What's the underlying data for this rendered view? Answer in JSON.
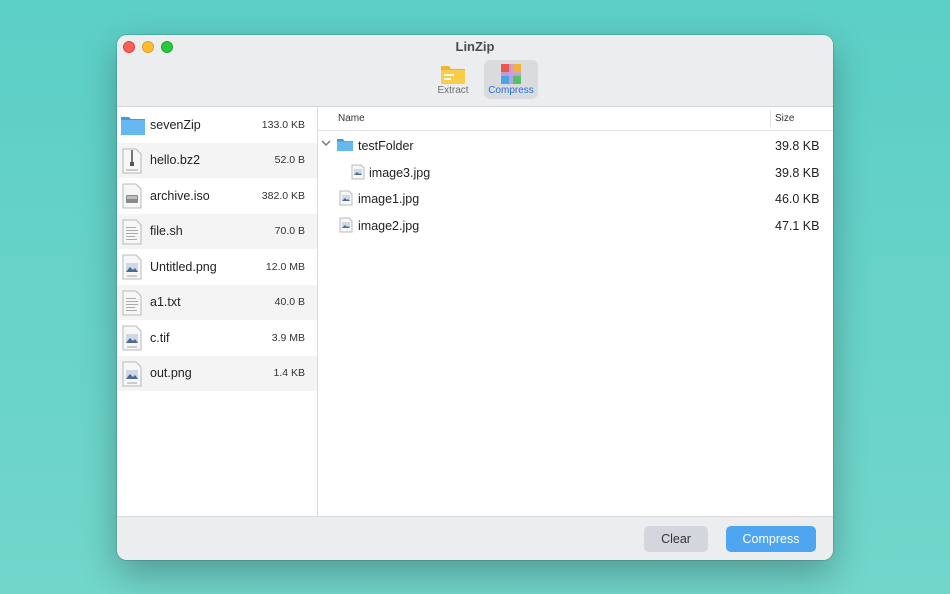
{
  "window": {
    "title": "LinZip"
  },
  "toolbar": {
    "tools": [
      {
        "label": "Extract",
        "icon": "folder-archive-icon",
        "active": false
      },
      {
        "label": "Compress",
        "icon": "compress-box-icon",
        "active": true
      }
    ]
  },
  "sidebar": {
    "items": [
      {
        "name": "sevenZip",
        "size": "133.0 KB",
        "icon": "folder-icon"
      },
      {
        "name": "hello.bz2",
        "size": "52.0 B",
        "icon": "archive-file-icon"
      },
      {
        "name": "archive.iso",
        "size": "382.0 KB",
        "icon": "disk-image-file-icon"
      },
      {
        "name": "file.sh",
        "size": "70.0 B",
        "icon": "text-file-icon"
      },
      {
        "name": "Untitled.png",
        "size": "12.0 MB",
        "icon": "image-file-icon"
      },
      {
        "name": "a1.txt",
        "size": "40.0 B",
        "icon": "text-file-icon"
      },
      {
        "name": "c.tif",
        "size": "3.9 MB",
        "icon": "image-file-icon"
      },
      {
        "name": "out.png",
        "size": "1.4 KB",
        "icon": "image-file-icon"
      }
    ]
  },
  "table": {
    "columns": {
      "name": "Name",
      "size": "Size"
    },
    "rows": [
      {
        "name": "testFolder",
        "size": "39.8 KB",
        "icon": "folder-icon",
        "expanded": true
      },
      {
        "name": "image3.jpg",
        "size": "39.8 KB",
        "icon": "image-file-icon"
      },
      {
        "name": "image1.jpg",
        "size": "46.0 KB",
        "icon": "image-file-icon"
      },
      {
        "name": "image2.jpg",
        "size": "47.1 KB",
        "icon": "image-file-icon"
      }
    ]
  },
  "footer": {
    "clear_label": "Clear",
    "compress_label": "Compress"
  },
  "colors": {
    "accent": "#4ea6f1",
    "background": "#5ccfc6"
  }
}
